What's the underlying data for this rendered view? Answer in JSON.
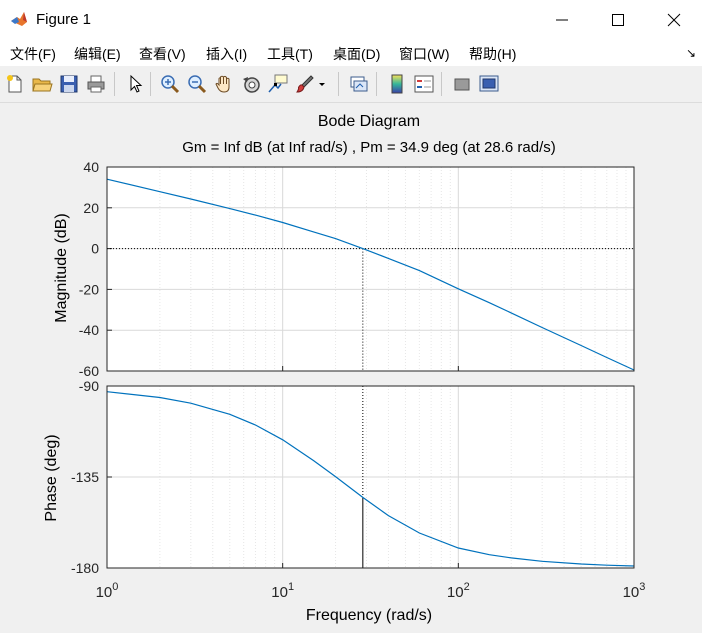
{
  "window": {
    "title": "Figure 1",
    "icon": "matlab-icon",
    "controls": [
      "minimize-icon",
      "maximize-icon",
      "close-icon"
    ]
  },
  "menu": [
    {
      "label": "文件(F)"
    },
    {
      "label": "编辑(E)"
    },
    {
      "label": "查看(V)"
    },
    {
      "label": "插入(I)"
    },
    {
      "label": "工具(T)"
    },
    {
      "label": "桌面(D)"
    },
    {
      "label": "窗口(W)"
    },
    {
      "label": "帮助(H)"
    }
  ],
  "menu_overflow_icon": "dock-arrow-icon",
  "toolbar": [
    "new-figure-icon",
    "open-file-icon",
    "save-icon",
    "print-icon",
    "select-pointer-icon",
    "zoom-in-icon",
    "zoom-out-icon",
    "pan-icon",
    "rotate-3d-icon",
    "data-cursor-icon",
    "brush-icon",
    "brush-dropdown-icon",
    "link-plot-icon",
    "colorbar-icon",
    "legend-icon",
    "hide-plot-tools-icon",
    "show-plot-tools-icon"
  ],
  "plot": {
    "title": "Bode Diagram",
    "subtitle": "Gm = Inf dB (at Inf rad/s) ,  Pm = 34.9 deg (at 28.6 rad/s)",
    "xlabel": "Frequency  (rad/s)",
    "ylabel_top": "Magnitude (dB)",
    "ylabel_bottom": "Phase (deg)",
    "x_tick_labels": [
      {
        "base": "10",
        "exp": "0"
      },
      {
        "base": "10",
        "exp": "1"
      },
      {
        "base": "10",
        "exp": "2"
      },
      {
        "base": "10",
        "exp": "3"
      }
    ],
    "mag_tick_labels": [
      "40",
      "20",
      "0",
      "-20",
      "-40",
      "-60"
    ],
    "phase_tick_labels": [
      "-90",
      "-135",
      "-180"
    ]
  },
  "chart_data": [
    {
      "type": "line",
      "name": "magnitude",
      "xscale": "log",
      "xlim": [
        1,
        1000
      ],
      "ylim": [
        -60,
        40
      ],
      "ylabel": "Magnitude (dB)",
      "grid": true,
      "x": [
        1,
        2,
        3,
        5,
        7,
        10,
        15,
        20,
        28.6,
        40,
        60,
        100,
        150,
        200,
        300,
        500,
        700,
        1000
      ],
      "y": [
        34.0,
        27.9,
        24.3,
        19.6,
        16.4,
        12.8,
        8.2,
        4.9,
        0.0,
        -4.8,
        -10.8,
        -19.7,
        -26.5,
        -31.5,
        -38.7,
        -47.5,
        -53.4,
        -59.5
      ],
      "color": "#0072bd"
    },
    {
      "type": "line",
      "name": "phase",
      "xscale": "log",
      "xlim": [
        1,
        1000
      ],
      "ylim": [
        -180,
        -90
      ],
      "ylabel": "Phase (deg)",
      "grid": true,
      "x": [
        1,
        2,
        3,
        5,
        7,
        10,
        15,
        20,
        28.6,
        40,
        60,
        100,
        150,
        200,
        300,
        500,
        700,
        1000
      ],
      "y": [
        -92.8,
        -95.7,
        -98.5,
        -104.0,
        -109.3,
        -116.6,
        -126.9,
        -134.8,
        -145.1,
        -154.1,
        -162.7,
        -170.1,
        -173.4,
        -175.0,
        -176.7,
        -178.0,
        -178.6,
        -179.0
      ],
      "color": "#0072bd"
    }
  ],
  "margins": {
    "gain_margin": "Inf dB",
    "gain_crossover": "Inf rad/s",
    "phase_margin_deg": 34.9,
    "phase_margin_frequency": 28.6,
    "phase_at_crossover": -145.1
  },
  "colors": {
    "axes_background": "#ffffff",
    "figure_background": "#f0f0f0",
    "line": "#0072bd",
    "grid": "#d9d9d9",
    "axis_text": "#262626"
  }
}
